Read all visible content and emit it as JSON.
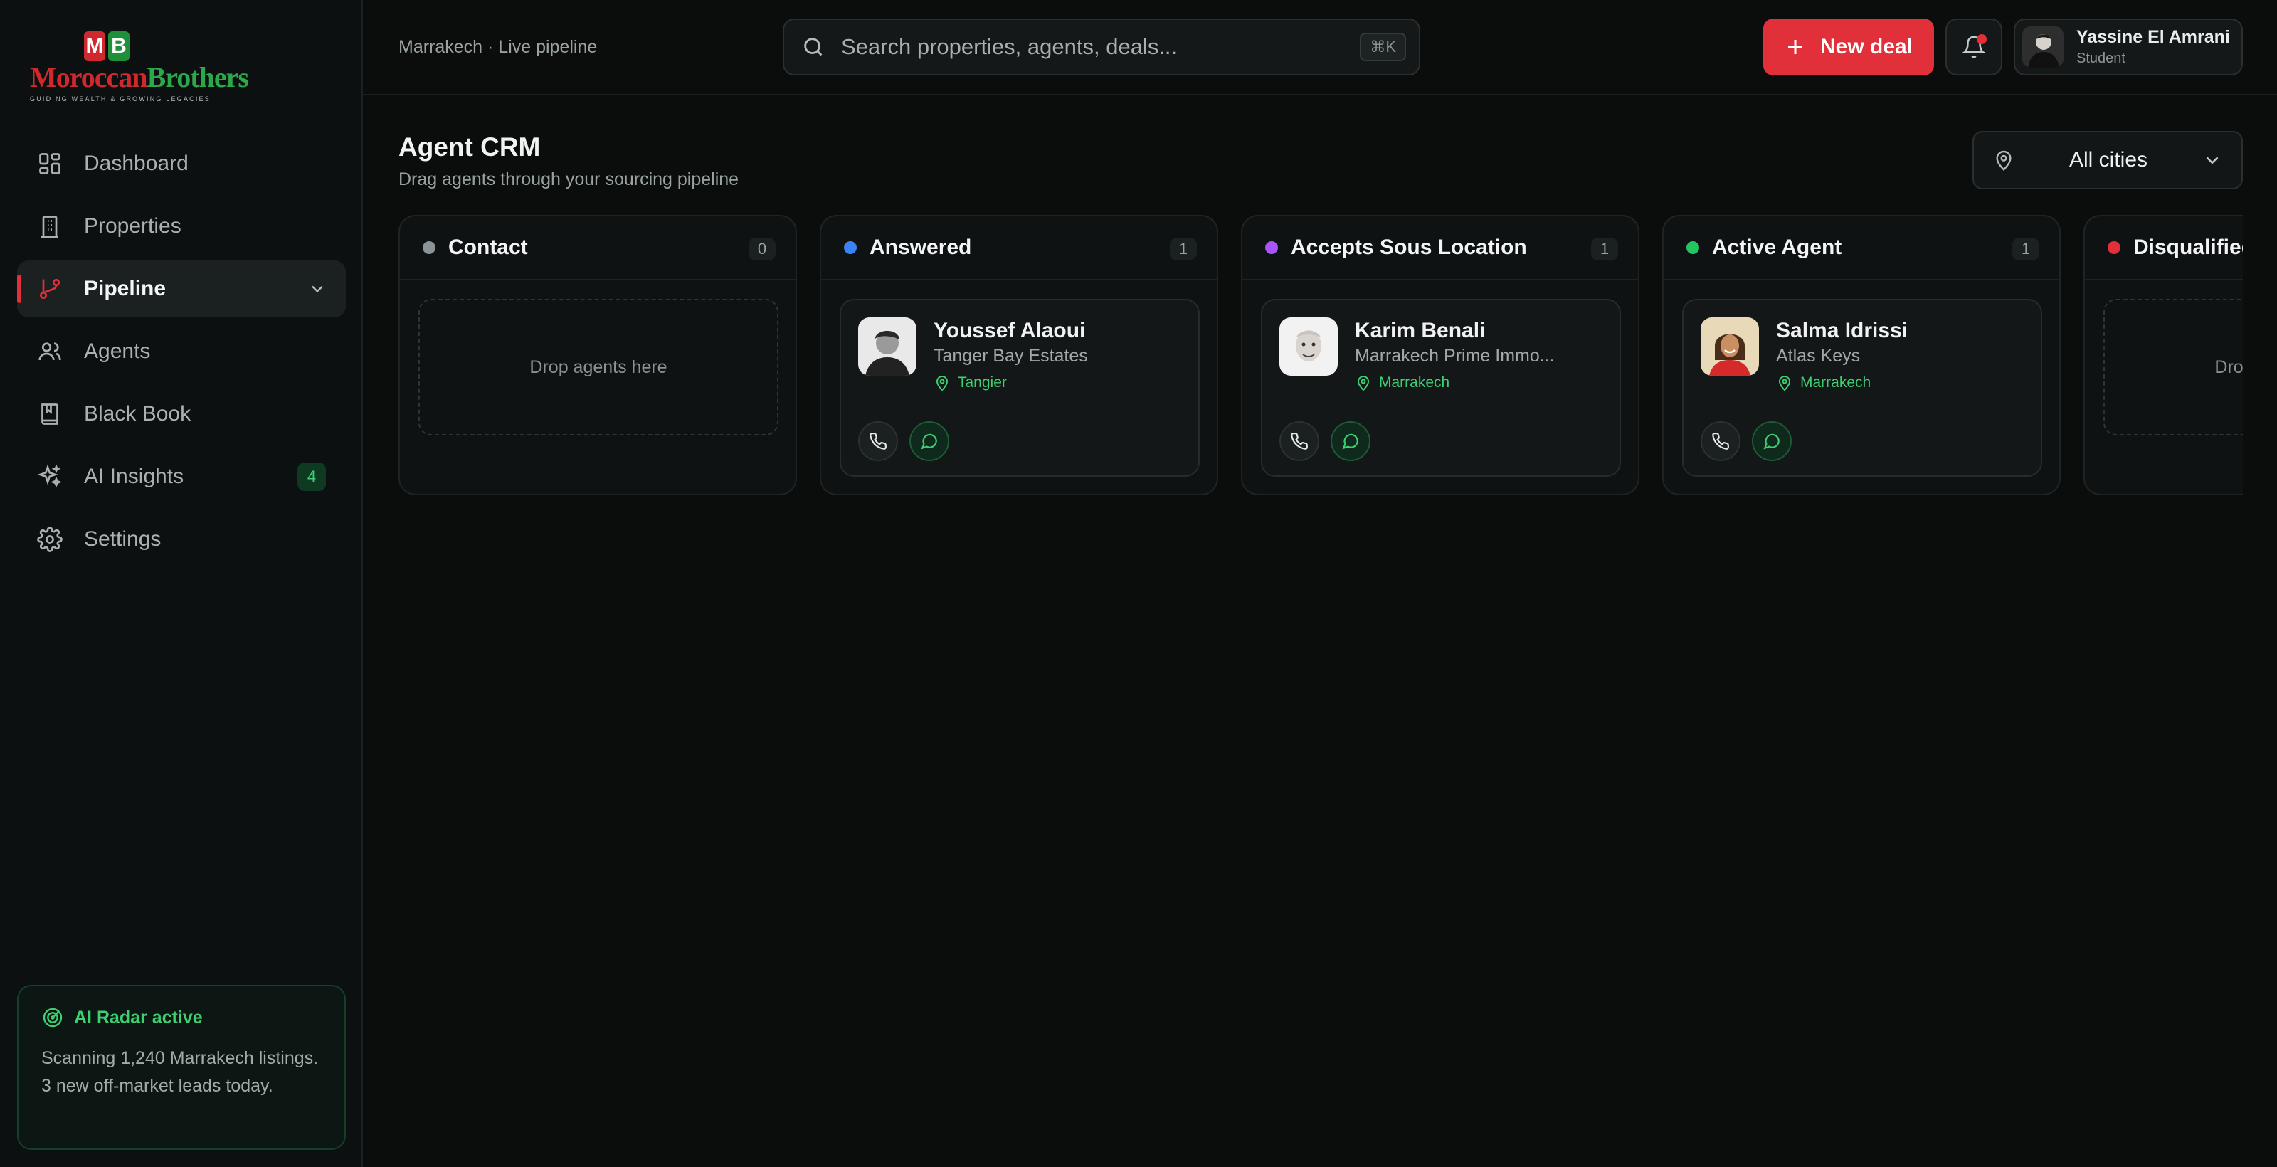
{
  "brand": {
    "logo_letters": [
      "M",
      "B"
    ],
    "wordmark_part1": "Moroccan",
    "wordmark_part2": "Brothers",
    "tagline": "GUIDING WEALTH & GROWING LEGACIES"
  },
  "sidebar": {
    "items": [
      {
        "label": "Dashboard",
        "icon": "grid-icon"
      },
      {
        "label": "Properties",
        "icon": "building-icon"
      },
      {
        "label": "Pipeline",
        "icon": "branch-icon",
        "active": true
      },
      {
        "label": "Agents",
        "icon": "users-icon"
      },
      {
        "label": "Black Book",
        "icon": "book-icon"
      },
      {
        "label": "AI Insights",
        "icon": "sparkles-icon",
        "badge": "4"
      },
      {
        "label": "Settings",
        "icon": "gear-icon"
      }
    ],
    "radar": {
      "title": "AI Radar active",
      "text": "Scanning 1,240 Marrakech listings. 3 new off-market leads today."
    }
  },
  "topbar": {
    "breadcrumb": "Marrakech · Live pipeline",
    "search_placeholder": "Search properties, agents, deals...",
    "search_shortcut": "⌘K",
    "new_deal_label": "New deal",
    "user": {
      "name": "Yassine El Amrani",
      "role": "Student"
    }
  },
  "page": {
    "title": "Agent CRM",
    "subtitle": "Drag agents through your sourcing pipeline",
    "city_filter": "All cities"
  },
  "board": {
    "columns": [
      {
        "title": "Contact",
        "count": "0",
        "dot_color": "#8a9396",
        "empty_text": "Drop agents here"
      },
      {
        "title": "Answered",
        "count": "1",
        "dot_color": "#3b82f6",
        "card": {
          "name": "Youssef Alaoui",
          "company": "Tanger Bay Estates",
          "location": "Tangier"
        }
      },
      {
        "title": "Accepts Sous Location",
        "count": "1",
        "dot_color": "#a855f7",
        "card": {
          "name": "Karim Benali",
          "company": "Marrakech Prime Immo...",
          "location": "Marrakech"
        }
      },
      {
        "title": "Active Agent",
        "count": "1",
        "dot_color": "#22c55e",
        "card": {
          "name": "Salma Idrissi",
          "company": "Atlas Keys",
          "location": "Marrakech"
        }
      },
      {
        "title": "Disqualified",
        "count": "",
        "dot_color": "#e2303a",
        "empty_text": "Drop agents here"
      }
    ]
  },
  "colors": {
    "accent_red": "#e2303a",
    "accent_green": "#3ecf72",
    "background": "#0b0d0d"
  }
}
